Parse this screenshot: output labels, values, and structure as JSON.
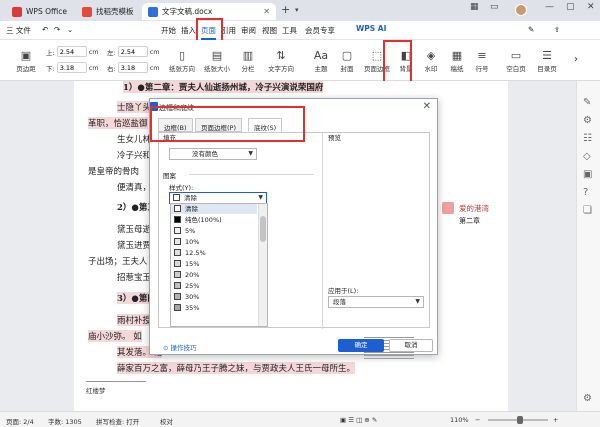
{
  "tabs": [
    {
      "label": "WPS Office",
      "icon": "wps-logo-icon",
      "color": "#d83b3b"
    },
    {
      "label": "找稻壳模板",
      "icon": "docer-icon",
      "color": "#e64a3b"
    },
    {
      "label": "文字文稿.docx",
      "icon": "word-doc-icon",
      "color": "#2f6fdb"
    }
  ],
  "menu": {
    "file": "三 文件",
    "items": [
      "开始",
      "插入",
      "页面",
      "引用",
      "审阅",
      "视图",
      "工具",
      "会员专享"
    ],
    "active": "页面",
    "ai": "WPS AI"
  },
  "ribbon": {
    "margins_label": "页边距",
    "top_label": "上:",
    "top_value": "2.54",
    "bottom_label": "下:",
    "bottom_value": "3.18",
    "left_label": "左:",
    "left_value": "2.54",
    "right_label": "右:",
    "right_value": "3.18",
    "unit": "cm",
    "orientation": "纸张方向",
    "size": "纸张大小",
    "columns": "分栏",
    "text_direction": "文字方向",
    "theme": "主题",
    "cover": "封面",
    "page_border": "页面边框",
    "background": "背景",
    "watermark": "水印",
    "manuscript": "稿纸",
    "line_number": "行号",
    "blank_page": "空白页",
    "toc_page": "目录页"
  },
  "document": {
    "lines": [
      "1）●第二章：贾夫人仙逝扬州城，冷子兴演说荣国府",
      "士隐丫头娇",
      "革职，恰巡盐御",
      "生女儿林",
      "冷子兴和贾",
      "是皇帝的骨肉",
      "便清真，见",
      "2）●第三",
      "黛玉母逝",
      "黛玉进贾府",
      "子出场；王夫人",
      "招惹宝玉；",
      "3）●第四",
      "雨村补授应",
      "庙小沙弥。 如",
      "其发落。 诸",
      "薛家百万之富，薛母乃王子腾之妹，与贾政夫人王氏一母所生。"
    ],
    "footnote": "红楼梦"
  },
  "comment": {
    "author": "爱的港湾",
    "text": "第二章"
  },
  "status": {
    "page": "页面: 2/4",
    "words": "字数: 1305",
    "spell": "拼写检查: 打开",
    "proof": "校对",
    "zoom": "110%"
  },
  "dialog": {
    "title": "边框和底纹",
    "tabs": [
      "边框(B)",
      "页面边框(P)",
      "底纹(S)"
    ],
    "active_tab": "底纹(S)",
    "fill_label": "填充",
    "fill_value": "没有颜色",
    "pattern_label": "图案",
    "style_label": "样式(Y):",
    "style_value": "清除",
    "style_options": [
      "清除",
      "纯色(100%)",
      "5%",
      "10%",
      "12.5%",
      "15%",
      "20%",
      "25%",
      "30%",
      "35%"
    ],
    "preview_label": "预览",
    "apply_label": "应用于(L):",
    "apply_value": "段落",
    "tips": "操作技巧",
    "ok": "确定",
    "cancel": "取消"
  }
}
